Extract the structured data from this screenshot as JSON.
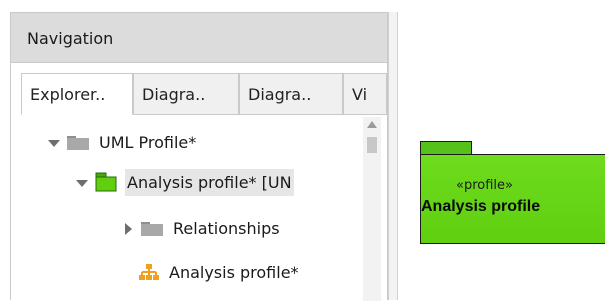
{
  "navigation": {
    "title": "Navigation",
    "tabs": [
      {
        "label": "Explorer.."
      },
      {
        "label": "Diagra.."
      },
      {
        "label": "Diagra.."
      },
      {
        "label": "Vi"
      }
    ]
  },
  "tree": {
    "items": [
      {
        "label": "UML Profile*",
        "icon": "gray-folder-icon",
        "expander": "expanded"
      },
      {
        "label": "Analysis profile* [UN",
        "icon": "green-package-icon",
        "expander": "expanded"
      },
      {
        "label": "Relationships",
        "icon": "gray-folder-icon",
        "expander": "collapsed"
      },
      {
        "label": "Analysis profile*",
        "icon": "diagram-icon",
        "expander": "none"
      }
    ]
  },
  "diagram": {
    "package_stereotype": "«profile»",
    "package_name": "Analysis profile"
  },
  "colors": {
    "package_fill": "#5fcf10",
    "header_bg": "#dcdcdc",
    "diagram_icon": "#f0a020"
  }
}
